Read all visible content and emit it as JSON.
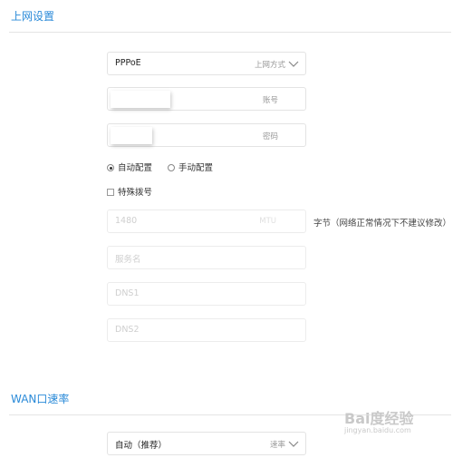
{
  "internet": {
    "title": "上网设置",
    "connection_type": {
      "value": "PPPoE",
      "suffix": "上网方式"
    },
    "account": {
      "suffix": "账号"
    },
    "password": {
      "suffix": "密码"
    },
    "config_mode": {
      "auto_label": "自动配置",
      "manual_label": "手动配置",
      "selected": "auto"
    },
    "special_dial": {
      "label": "特殊拨号",
      "checked": false
    },
    "mtu": {
      "value": "1480",
      "suffix": "MTU",
      "note": "字节（网络正常情况下不建议修改）"
    },
    "service_name": {
      "placeholder": "服务名"
    },
    "dns1": {
      "placeholder": "DNS1"
    },
    "dns2": {
      "placeholder": "DNS2"
    }
  },
  "wan_speed": {
    "title": "WAN口速率",
    "speed": {
      "value": "自动（推荐）",
      "suffix": "速率"
    }
  },
  "watermark": {
    "text": "Bai度经验",
    "sub": "jingyan.baidu.com"
  },
  "colors": {
    "accent": "#2a8ad8"
  },
  "icons": {
    "dropdown": "chevron-down-icon"
  }
}
